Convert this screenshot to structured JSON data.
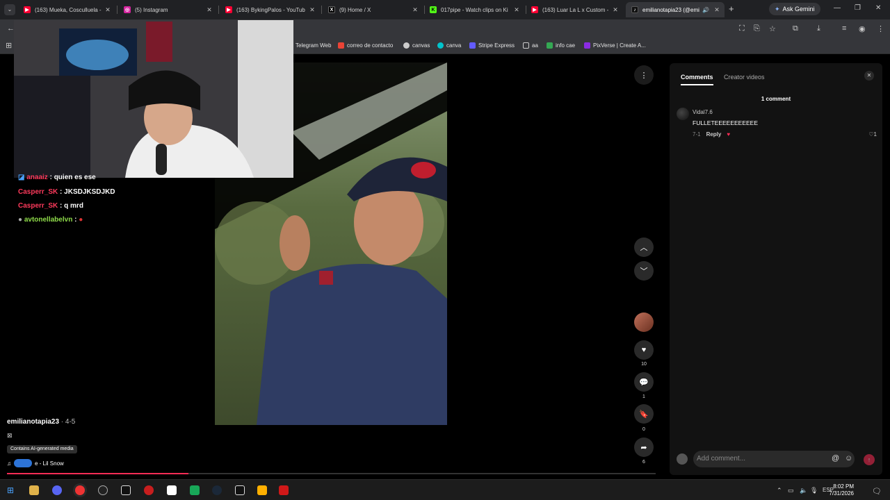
{
  "tabs": [
    {
      "title": "(163) Mueka, Cosculluela - L",
      "close": "✕",
      "color": "#ff0033",
      "icon": "youtube-icon"
    },
    {
      "title": "(5) Instagram",
      "close": "✕",
      "color": "#d6249f",
      "icon": "instagram-icon"
    },
    {
      "title": "(163) BykingPalos - YouTub",
      "close": "✕",
      "color": "#ff0033",
      "icon": "youtube-icon"
    },
    {
      "title": "(9) Home / X",
      "close": "✕",
      "color": "#000000",
      "icon": "x-icon"
    },
    {
      "title": "017pipe - Watch clips on Ki",
      "close": "✕",
      "color": "#53fc18",
      "icon": "kick-icon"
    },
    {
      "title": "(163) Luar La L x Custom - L",
      "close": "✕",
      "color": "#ff0033",
      "icon": "youtube-icon"
    },
    {
      "title": "emilianotapia23 (@emi",
      "close": "✕",
      "color": "#111111",
      "icon": "tiktok-icon",
      "active": true
    }
  ],
  "ask_gemini": "Ask Gemini",
  "bookmarks": [
    {
      "label": "Telegram Web",
      "color": "#2aabee"
    },
    {
      "label": "correo de contacto",
      "color": "#ea4335"
    },
    {
      "label": "canvas",
      "color": "#cccccc"
    },
    {
      "label": "canva",
      "color": "#00c4cc"
    },
    {
      "label": "Stripe Express",
      "color": "#635bff"
    },
    {
      "label": "aa",
      "color": "#888888"
    },
    {
      "label": "info cae",
      "color": "#34a853"
    },
    {
      "label": "PixVerse | Create A...",
      "color": "#8a2be2"
    }
  ],
  "chat": [
    {
      "user": "anaaiz",
      "sep": " : ",
      "msg": "quien es ese"
    },
    {
      "user": "Casperr_SK",
      "sep": " : ",
      "msg": "JKSDJKSDJKD"
    },
    {
      "user": "Casperr_SK",
      "sep": " : ",
      "msg": "q mrd"
    },
    {
      "user": "avtonellabelvn",
      "sep": " : ",
      "msg": ""
    }
  ],
  "actions": {
    "likes": "10",
    "comments": "1",
    "saves": "0",
    "shares": "6"
  },
  "video_info": {
    "author": "emilianotapia23",
    "date": " · 4-5",
    "ai_badge": "Contains AI-generated media",
    "music": "e - Lil Snow",
    "progress": 0.28
  },
  "panel": {
    "tab_comments": "Comments",
    "tab_creator": "Creator videos",
    "count": "1 comment",
    "comment": {
      "user": "Vidal7.6",
      "text": "FULLETEEEEEEEEEEE",
      "date": "7-1",
      "reply": "Reply",
      "likes": "1"
    },
    "input_placeholder": "Add comment..."
  },
  "tray": {
    "lang": "ESP",
    "time": "8:02 PM",
    "date": "7/31/2026"
  }
}
